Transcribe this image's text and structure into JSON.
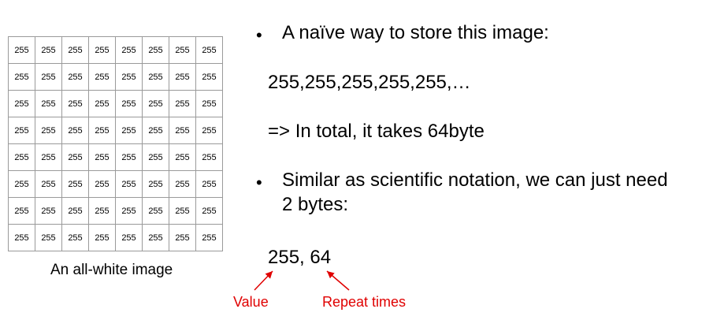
{
  "grid": {
    "cells": [
      [
        "255",
        "255",
        "255",
        "255",
        "255",
        "255",
        "255",
        "255"
      ],
      [
        "255",
        "255",
        "255",
        "255",
        "255",
        "255",
        "255",
        "255"
      ],
      [
        "255",
        "255",
        "255",
        "255",
        "255",
        "255",
        "255",
        "255"
      ],
      [
        "255",
        "255",
        "255",
        "255",
        "255",
        "255",
        "255",
        "255"
      ],
      [
        "255",
        "255",
        "255",
        "255",
        "255",
        "255",
        "255",
        "255"
      ],
      [
        "255",
        "255",
        "255",
        "255",
        "255",
        "255",
        "255",
        "255"
      ],
      [
        "255",
        "255",
        "255",
        "255",
        "255",
        "255",
        "255",
        "255"
      ],
      [
        "255",
        "255",
        "255",
        "255",
        "255",
        "255",
        "255",
        "255"
      ]
    ],
    "caption": "An all-white image"
  },
  "bullets": {
    "b1": "A naïve way to store this image:",
    "b2_line1": "Similar as scientific notation, we can just need",
    "b2_line2": "2 bytes:"
  },
  "text": {
    "naive_values": "255,255,255,255,255,…",
    "total": "=> In total, it takes 64byte",
    "encoded": "255, 64"
  },
  "annotations": {
    "value_label": "Value",
    "repeat_label": "Repeat times",
    "color": "#e00000"
  }
}
